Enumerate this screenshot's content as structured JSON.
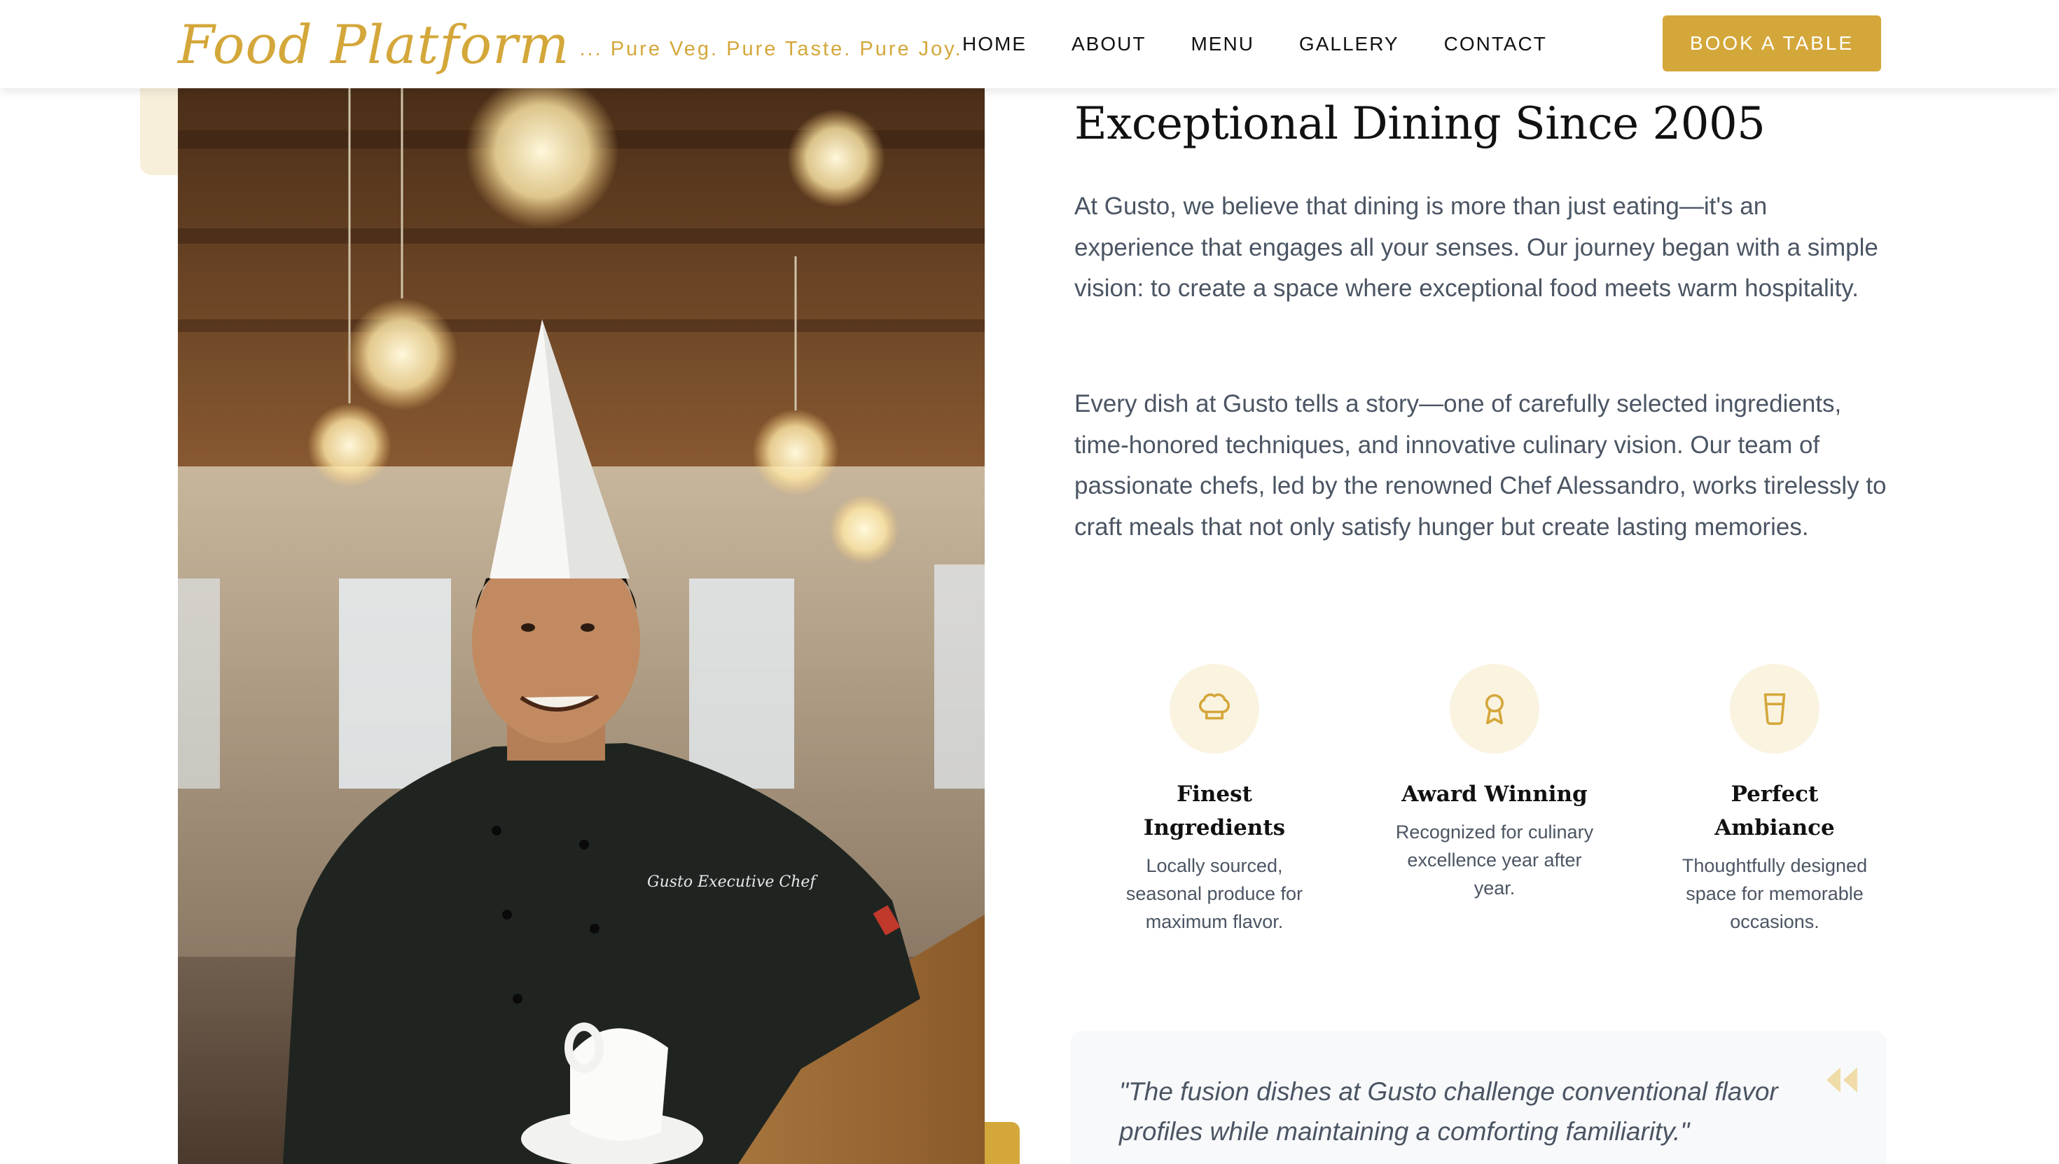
{
  "header": {
    "brand_name": "Food Platform",
    "tagline": "... Pure Veg. Pure Taste. Pure Joy.",
    "nav": [
      "HOME",
      "ABOUT",
      "MENU",
      "GALLERY",
      "CONTACT"
    ],
    "cta_label": "BOOK A TABLE"
  },
  "about": {
    "heading": "Exceptional Dining Since 2005",
    "paragraphs": [
      "At Gusto, we believe that dining is more than just eating—it's an experience that engages all your senses. Our journey began with a simple vision: to create a space where exceptional food meets warm hospitality.",
      "Every dish at Gusto tells a story—one of carefully selected ingredients, time-honored techniques, and innovative culinary vision. Our team of passionate chefs, led by the renowned Chef Alessandro, works tirelessly to craft meals that not only satisfy hunger but create lasting memories."
    ],
    "features": [
      {
        "icon": "chef-hat-icon",
        "title": "Finest Ingredients",
        "description": "Locally sourced, seasonal produce for maximum flavor."
      },
      {
        "icon": "award-icon",
        "title": "Award Winning",
        "description": "Recognized for culinary excellence year after year."
      },
      {
        "icon": "glass-icon",
        "title": "Perfect Ambiance",
        "description": "Thoughtfully designed space for memorable occasions."
      }
    ],
    "quote": "\"The fusion dishes at Gusto challenge conventional flavor profiles while maintaining a comforting familiarity.\"",
    "photo_embroidery": "Gusto Executive Chef"
  },
  "colors": {
    "accent": "#d4a73a",
    "accent_light": "#faf3e0",
    "text_dark": "#111111",
    "text_muted": "#4b5563"
  }
}
